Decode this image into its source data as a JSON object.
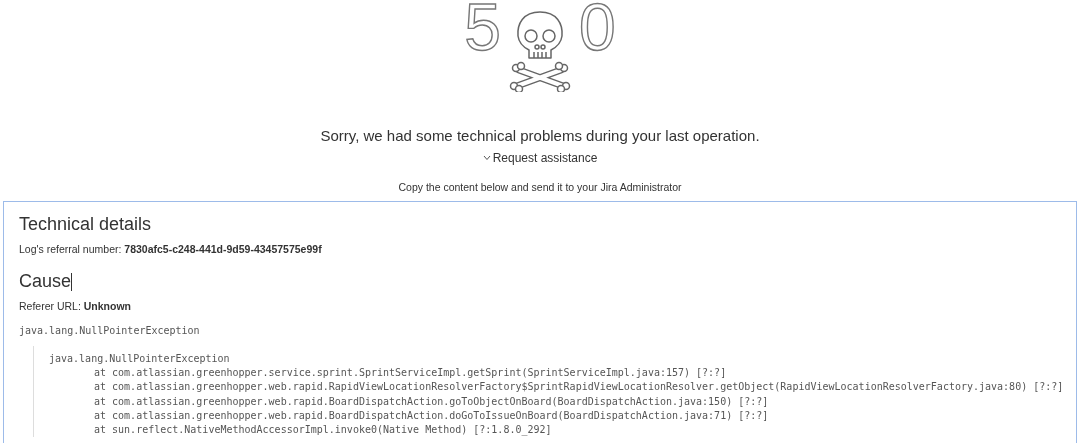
{
  "error_code": {
    "digits": [
      "5",
      "0"
    ]
  },
  "message": "Sorry, we had some technical problems during your last operation.",
  "request_assistance": "Request assistance",
  "copy_instruction": "Copy the content below and send it to your Jira Administrator",
  "details": {
    "title": "Technical details",
    "referral": "Log's referral number: **7830afc5-c248-441d-9d59-43457575e99f**",
    "cause_title": "Cause",
    "referer": "Referer URL: **Unknown**",
    "exception": "java.lang.NullPointerException",
    "stack_trace": {
      "header": "java.lang.NullPointerException",
      "frames": [
        "at com.atlassian.greenhopper.service.sprint.SprintServiceImpl.getSprint(SprintServiceImpl.java:157) [?:?]",
        "at com.atlassian.greenhopper.web.rapid.RapidViewLocationResolverFactory$SprintRapidViewLocationResolver.getObject(RapidViewLocationResolverFactory.java:80) [?:?]",
        "at com.atlassian.greenhopper.web.rapid.BoardDispatchAction.goToObjectOnBoard(BoardDispatchAction.java:150) [?:?]",
        "at com.atlassian.greenhopper.web.rapid.BoardDispatchAction.doGoToIssueOnBoard(BoardDispatchAction.java:71) [?:?]",
        "at sun.reflect.NativeMethodAccessorImpl.invoke0(Native Method) [?:1.8.0_292]"
      ]
    }
  }
}
